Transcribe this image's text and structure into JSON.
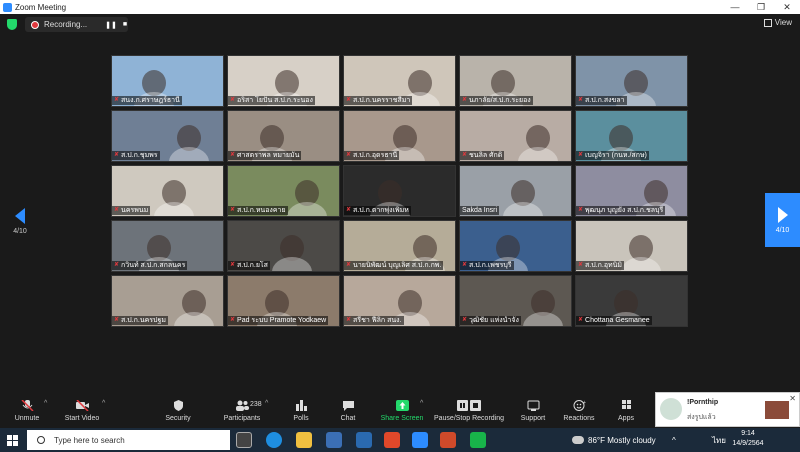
{
  "window": {
    "title": "Zoom Meeting",
    "controls": [
      "—",
      "❐",
      "✕"
    ]
  },
  "recording": {
    "label": "Recording...",
    "pause": "❚❚",
    "stop": "■"
  },
  "view": {
    "label": "View"
  },
  "pager": {
    "left": "4/10",
    "right": "4/10"
  },
  "tiles": [
    {
      "name": "สนง.ก.ศราษฎร์ธานี",
      "muted": true,
      "bg": "#8fb3d6"
    },
    {
      "name": "อริสา โยปัน ส.ป.ก.ระนอง",
      "muted": true,
      "bg": "#d7d0c7"
    },
    {
      "name": "ส.ป.ก.นครราชสีมา",
      "muted": true,
      "bg": "#cfc6ba"
    },
    {
      "name": "นภาลัย/ส.ป.ก.ระยอง",
      "muted": true,
      "bg": "#b9b3aa"
    },
    {
      "name": "ส.ป.ก.สงขลา",
      "muted": true,
      "bg": "#7f93a8"
    },
    {
      "name": "ส.ป.ก.ชุมพร",
      "muted": true,
      "bg": "#6f7f95"
    },
    {
      "name": "ศาสตราพล หมายมั่น",
      "muted": true,
      "bg": "#9a8e83"
    },
    {
      "name": "ส.ป.ก.อุดรธานี",
      "muted": true,
      "bg": "#a8988c"
    },
    {
      "name": "ชนลิล ศักดิ",
      "muted": true,
      "bg": "#b8aca4"
    },
    {
      "name": "เบญจิรา (กนห./สกษ)",
      "muted": true,
      "bg": "#5b8f9e"
    },
    {
      "name": "นครพนม",
      "muted": true,
      "bg": "#cfc9bf"
    },
    {
      "name": "ส.ป.ก.หนองคาย",
      "muted": true,
      "bg": "#7a8b5e"
    },
    {
      "name": "ส.ป.ก.ตากพุ่งเพิ่มห",
      "muted": true,
      "bg": "#2b2b2b"
    },
    {
      "name": "Sakda Insri",
      "muted": false,
      "bg": "#9aa0a7"
    },
    {
      "name": "พุฒนุภ บุญยัง ส.ป.ก.ชลบุรี",
      "muted": true,
      "bg": "#8e8da0"
    },
    {
      "name": "กวินท์ ส.ป.ก.สกลนคร",
      "muted": true,
      "bg": "#6d737a"
    },
    {
      "name": "ส.ป.ก.ยโส",
      "muted": true,
      "bg": "#4c4a47"
    },
    {
      "name": "นายนิพัฒน์ บุญเลิศ ส.ป.ก.กพ.",
      "muted": true,
      "bg": "#b5ac98"
    },
    {
      "name": "ส.ป.ก.เพชรบุรี",
      "muted": true,
      "bg": "#3b5f8e"
    },
    {
      "name": "ส.ป.ก.อุทนิมิ",
      "muted": true,
      "bg": "#c9c4bb"
    },
    {
      "name": "ส.ป.ก.นครปฐม",
      "muted": true,
      "bg": "#a89e93"
    },
    {
      "name": "Pad ระบบ Pramote Yodkaew",
      "muted": true,
      "bg": "#8c7b6b"
    },
    {
      "name": "สรีชา ฟีลิก สนง.",
      "muted": true,
      "bg": "#b7a89b"
    },
    {
      "name": "วุฒิชัย แห่งน้ำจัง",
      "muted": true,
      "bg": "#5d5852"
    },
    {
      "name": "Chottana Gesmanee",
      "muted": true,
      "bg": "#3a3a3a"
    }
  ],
  "toolbar": {
    "unmute": "Unmute",
    "start_video": "Start Video",
    "security": "Security",
    "participants": "Participants",
    "participants_count": "238",
    "polls": "Polls",
    "chat": "Chat",
    "share_screen": "Share Screen",
    "pause_recording": "Pause/Stop Recording",
    "support": "Support",
    "reactions": "Reactions",
    "apps": "Apps"
  },
  "notification": {
    "name": "!Pornthip",
    "message": "ส่งรูปแล้ว",
    "close": "✕"
  },
  "taskbar": {
    "search_placeholder": "Type here to search",
    "weather": "86°F  Mostly cloudy",
    "time": "9:14",
    "date": "14/9/2564",
    "lang": "ไทย",
    "chevron": "^"
  }
}
